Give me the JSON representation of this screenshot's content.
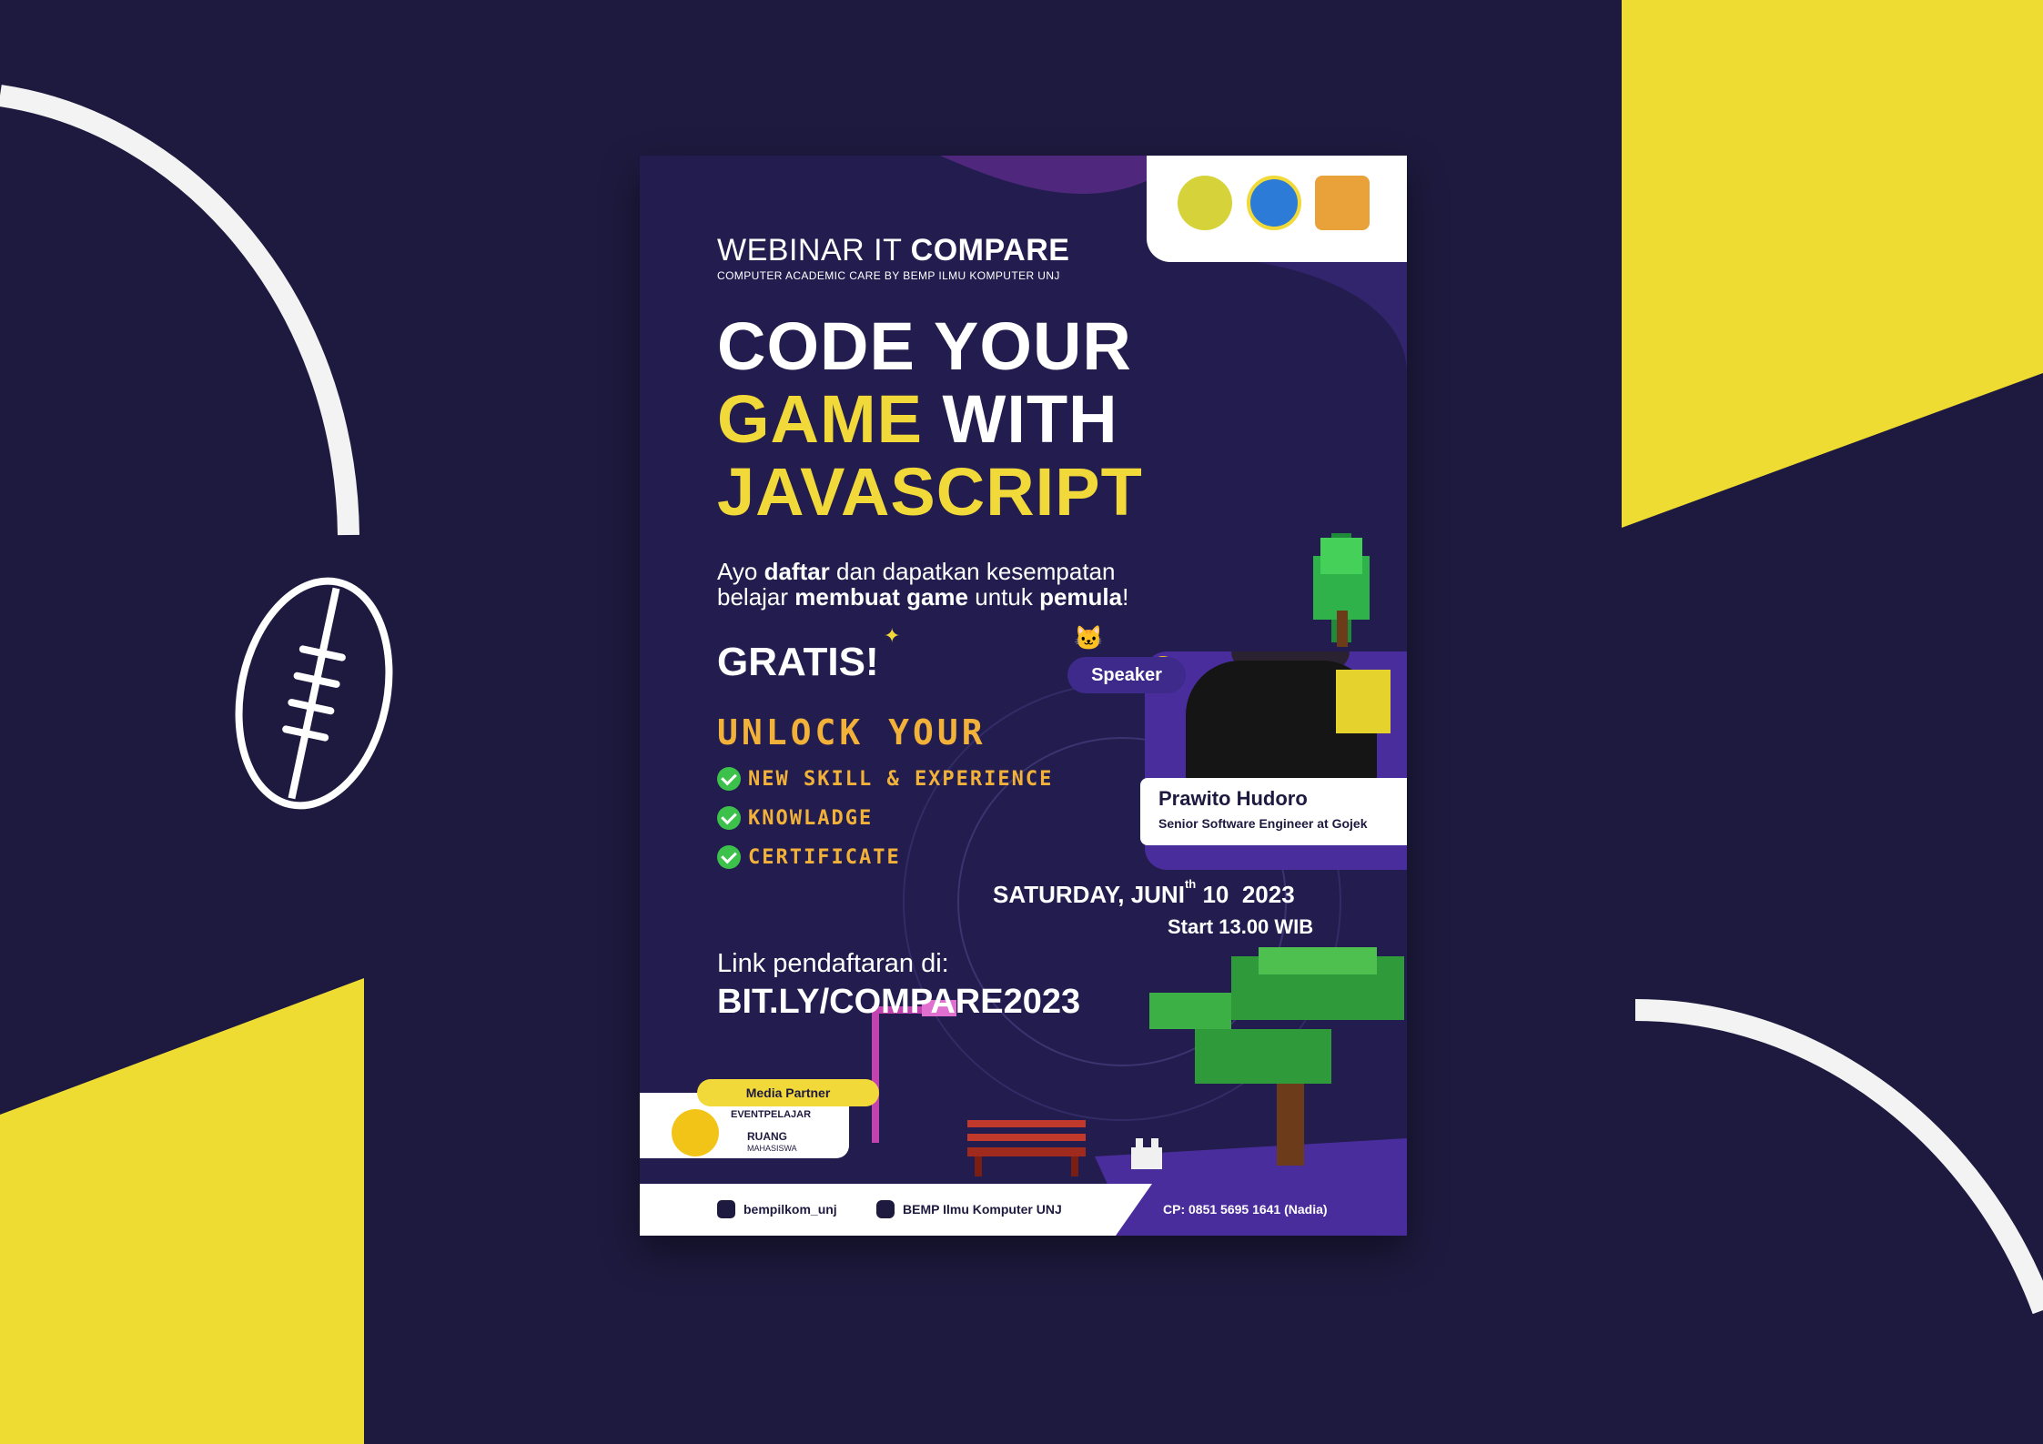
{
  "colors": {
    "background": "#1e1a3f",
    "accent_yellow": "#f2d93a",
    "poster_bg": "#231c4e",
    "purple": "#4a2d9c",
    "pixel_orange": "#f2b23a",
    "check_green": "#3cc24b"
  },
  "poster": {
    "logos": [
      "university-logo-icon",
      "faculty-logo-icon",
      "kabinet-logo-icon"
    ],
    "webinar_prefix": "WEBINAR IT ",
    "webinar_name": "COMPARE",
    "webinar_subtitle": "COMPUTER ACADEMIC CARE BY BEMP ILMU KOMPUTER UNJ",
    "headline": {
      "line1": "CODE YOUR",
      "line2_highlight": "GAME",
      "line2_rest": " WITH",
      "line3": "JAVASCRIPT"
    },
    "tagline": {
      "p1": "Ayo ",
      "b1": "daftar",
      "p2": " dan dapatkan kesempatan",
      "p3": "belajar ",
      "b2": "membuat game",
      "p4": " untuk ",
      "b3": "pemula",
      "p5": "!"
    },
    "gratis": "GRATIS!",
    "unlock_title": "UNLOCK YOUR",
    "benefits": [
      "NEW SKILL & EXPERIENCE",
      "KNOWLADGE",
      "CERTIFICATE"
    ],
    "speaker": {
      "label": "Speaker",
      "name": "Prawito Hudoro",
      "role": "Senior Software Engineer at Gojek"
    },
    "event_date": {
      "prefix": "SATURDAY, JUNI",
      "sup": "th",
      "day": "10",
      "year": "2023",
      "time": "Start 13.00 WIB"
    },
    "registration": {
      "label": "Link pendaftaran di:",
      "url": "BIT.LY/COMPARE2023"
    },
    "media_partner": {
      "label": "Media Partner",
      "partners": [
        "EVENTPELAJAR",
        "RUANG",
        "MAHASISWA"
      ]
    },
    "footer": {
      "instagram": "bempilkom_unj",
      "youtube": "BEMP Ilmu Komputer UNJ",
      "contact": "CP: 0851 5695 1641 (Nadia)"
    }
  }
}
